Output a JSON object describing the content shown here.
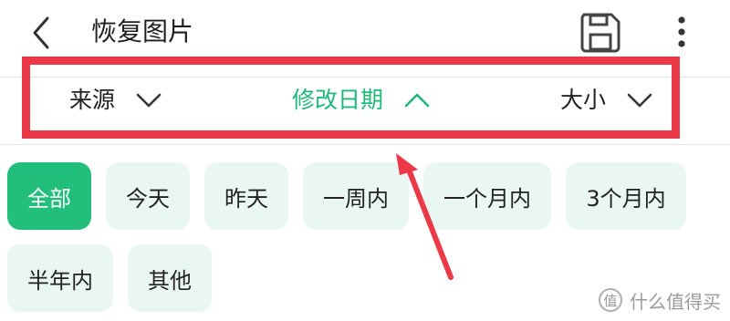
{
  "header": {
    "title": "恢复图片",
    "back_icon": "chevron-left-icon",
    "save_icon": "save-icon",
    "more_icon": "more-vertical-icon"
  },
  "sort_bar": {
    "items": [
      {
        "label": "来源",
        "arrow": "chevron-down-icon",
        "active": false
      },
      {
        "label": "修改日期",
        "arrow": "chevron-up-icon",
        "active": true
      },
      {
        "label": "大小",
        "arrow": "chevron-down-icon",
        "active": false
      }
    ]
  },
  "time_filters": {
    "chips": [
      {
        "label": "全部",
        "selected": true
      },
      {
        "label": "今天",
        "selected": false
      },
      {
        "label": "昨天",
        "selected": false
      },
      {
        "label": "一周内",
        "selected": false
      },
      {
        "label": "一个月内",
        "selected": false
      },
      {
        "label": "3个月内",
        "selected": false
      },
      {
        "label": "半年内",
        "selected": false
      },
      {
        "label": "其他",
        "selected": false
      }
    ]
  },
  "annotation": {
    "color": "#ec3947"
  },
  "colors": {
    "accent": "#22bf7c",
    "chip_bg": "#eaf6f1"
  },
  "watermark": {
    "logo_char": "值",
    "text": "什么值得买"
  }
}
